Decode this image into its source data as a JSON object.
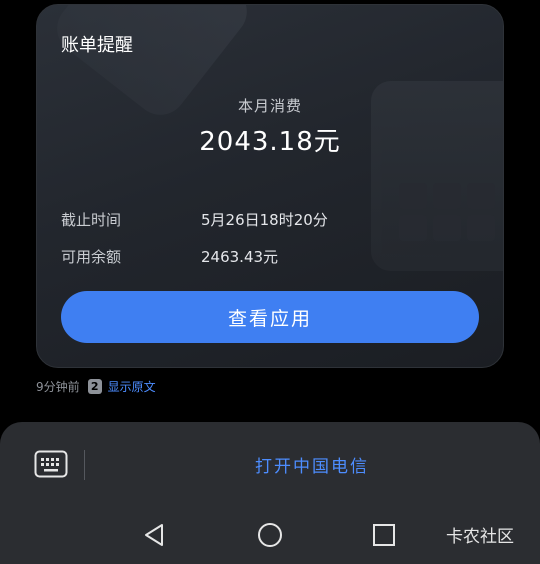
{
  "card": {
    "title": "账单提醒",
    "month_label": "本月消费",
    "amount": "2043.18元",
    "rows": [
      {
        "label": "截止时间",
        "value": "5月26日18时20分"
      },
      {
        "label": "可用余额",
        "value": "2463.43元"
      }
    ],
    "button_label": "查看应用"
  },
  "meta": {
    "time": "9分钟前",
    "badge": "2",
    "link": "显示原文"
  },
  "panel": {
    "open_action": "打开中国电信"
  },
  "watermark": "卡农社区",
  "colors": {
    "accent": "#3f7ff2",
    "link": "#4d8dff",
    "background": "#000000",
    "panel": "#2b2d31"
  }
}
